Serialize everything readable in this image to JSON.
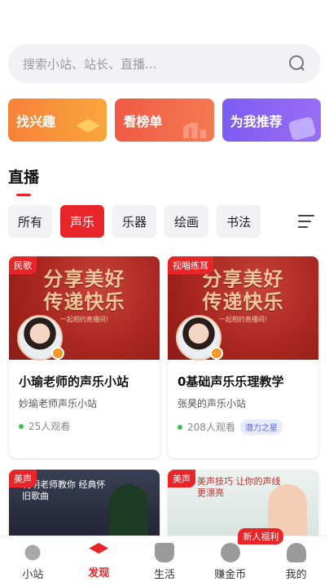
{
  "search": {
    "placeholder": "搜索小站、站长、直播..."
  },
  "quick": [
    {
      "label": "找兴趣"
    },
    {
      "label": "看榜单"
    },
    {
      "label": "为我推荐"
    }
  ],
  "section": {
    "title": "直播"
  },
  "tabs": [
    "所有",
    "声乐",
    "乐器",
    "绘画",
    "书法"
  ],
  "active_tab": "声乐",
  "cards": [
    {
      "tag": "民歌",
      "banner_title_1": "分享美好",
      "banner_title_2": "传递快乐",
      "banner_sub": "一起相约直播间!",
      "name": "小瑜老师的声乐小站",
      "owner": "妙瑜老师声乐小站",
      "viewers": "25人观看"
    },
    {
      "tag": "视唱练耳",
      "banner_title_1": "分享美好",
      "banner_title_2": "传递快乐",
      "banner_sub": "一起相约直播间!",
      "name": "0基础声乐乐理教学",
      "owner": "张昊的声乐小站",
      "viewers": "208人观看",
      "badge": "潜力之星"
    },
    {
      "tag": "美声",
      "banner_text": "利明老师教你 经典怀旧歌曲"
    },
    {
      "tag": "美声",
      "banner_text": "美声技巧 让你的声线更漂亮"
    }
  ],
  "nav": [
    {
      "label": "小站",
      "icon": "planet-icon"
    },
    {
      "label": "发现",
      "icon": "graduation-cap-icon"
    },
    {
      "label": "生活",
      "icon": "cup-icon"
    },
    {
      "label": "赚金币",
      "icon": "coin-icon",
      "badge": "新人福利"
    },
    {
      "label": "我的",
      "icon": "user-icon"
    }
  ],
  "colors": {
    "accent": "#e8262a",
    "live": "#3bbf4f"
  }
}
